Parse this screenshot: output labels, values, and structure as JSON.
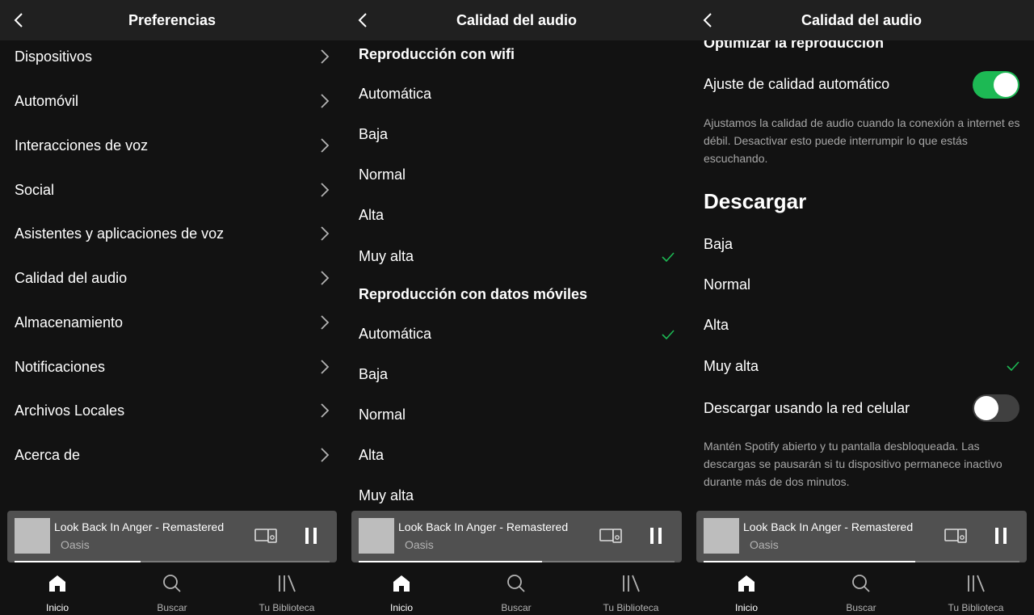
{
  "colors": {
    "background": "#121212",
    "topbar": "#202020",
    "accent": "#1db954",
    "player": "#505050"
  },
  "screens": [
    {
      "title": "Preferencias",
      "items": [
        {
          "label": "Dispositivos"
        },
        {
          "label": "Automóvil"
        },
        {
          "label": "Interacciones de voz"
        },
        {
          "label": "Social"
        },
        {
          "label": "Asistentes y aplicaciones de voz"
        },
        {
          "label": "Calidad del audio"
        },
        {
          "label": "Almacenamiento"
        },
        {
          "label": "Notificaciones"
        },
        {
          "label": "Archivos Locales"
        },
        {
          "label": "Acerca de"
        }
      ]
    },
    {
      "title": "Calidad del audio",
      "wifi_header": "Reproducción con wifi",
      "wifi_options": [
        {
          "label": "Automática",
          "selected": false
        },
        {
          "label": "Baja",
          "selected": false
        },
        {
          "label": "Normal",
          "selected": false
        },
        {
          "label": "Alta",
          "selected": false
        },
        {
          "label": "Muy alta",
          "selected": true
        }
      ],
      "mobile_header": "Reproducción con datos móviles",
      "mobile_options": [
        {
          "label": "Automática",
          "selected": true
        },
        {
          "label": "Baja",
          "selected": false
        },
        {
          "label": "Normal",
          "selected": false
        },
        {
          "label": "Alta",
          "selected": false
        },
        {
          "label": "Muy alta",
          "selected": false
        }
      ]
    },
    {
      "title": "Calidad del audio",
      "optimize_header": "Optimizar la reproducción",
      "auto_quality_label": "Ajuste de calidad automático",
      "auto_quality_on": true,
      "auto_quality_desc": "Ajustamos la calidad de audio cuando la conexión a internet es débil. Desactivar esto puede interrumpir lo que estás escuchando.",
      "download_header": "Descargar",
      "download_options": [
        {
          "label": "Baja",
          "selected": false
        },
        {
          "label": "Normal",
          "selected": false
        },
        {
          "label": "Alta",
          "selected": false
        },
        {
          "label": "Muy alta",
          "selected": true
        }
      ],
      "cellular_label": "Descargar usando la red celular",
      "cellular_on": false,
      "cellular_desc": "Mantén Spotify abierto y tu pantalla desbloqueada. Las descargas se pausarán si tu dispositivo permanece inactivo durante más de dos minutos."
    }
  ],
  "player": {
    "song": "Look Back In Anger - Remastered",
    "artist": "Oasis",
    "progress": [
      0.4,
      0.58,
      0.67
    ]
  },
  "nav": [
    {
      "label": "Inicio",
      "icon": "home-icon"
    },
    {
      "label": "Buscar",
      "icon": "search-icon"
    },
    {
      "label": "Tu Biblioteca",
      "icon": "library-icon"
    }
  ]
}
